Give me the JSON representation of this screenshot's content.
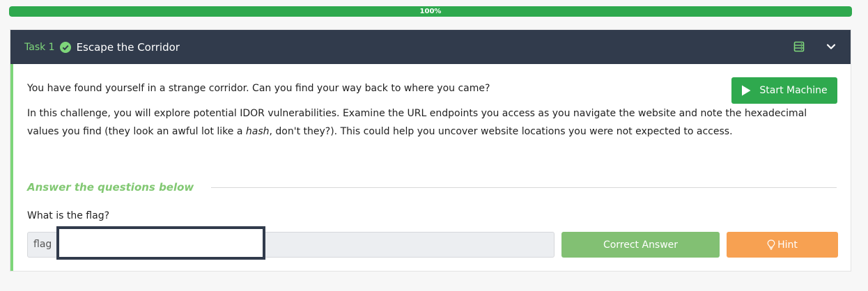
{
  "progress": {
    "percent_label": "100%",
    "value": 1.0,
    "color": "#2fa94e"
  },
  "task": {
    "number_label": "Task 1",
    "title": "Escape the Corridor",
    "icons": {
      "status": "check-circle-icon",
      "machine": "server-icon",
      "toggle": "chevron-down-icon"
    }
  },
  "body": {
    "intro": "You have found yourself in a strange corridor. Can you find your way back to where you came?",
    "description_a": "In this challenge, you will explore potential IDOR vulnerabilities. Examine the URL endpoints you access as you navigate the website and note the hexadecimal values you find (they look an awful lot like a ",
    "description_em": "hash",
    "description_b": ", don't they?). This could help you uncover website locations you were not expected to access.",
    "start_button": "Start Machine"
  },
  "questions": {
    "heading": "Answer the questions below",
    "items": [
      {
        "question": "What is the flag?",
        "answer_value": "flag",
        "submit_label": "Correct Answer",
        "hint_label": "Hint"
      }
    ]
  },
  "colors": {
    "header_bg": "#313b4c",
    "accent_green": "#7ed67a",
    "correct_green": "#82c073",
    "hint_orange": "#f7a152"
  }
}
